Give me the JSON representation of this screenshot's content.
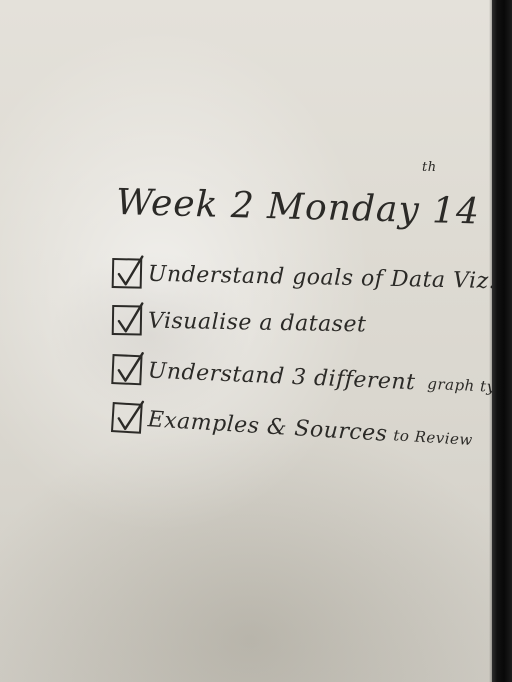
{
  "whiteboard": {
    "title": "Week 2 Monday 14",
    "title_superscript": "th",
    "checklist": [
      {
        "text": "Understand goals of Data Viz.",
        "checked": true
      },
      {
        "text": "Visualise a dataset",
        "checked": true
      },
      {
        "text": "Understand 3 different",
        "tail": "graph types",
        "checked": true
      },
      {
        "text": "Examples & Sources",
        "tail": "to Review",
        "checked": true
      }
    ],
    "ink_color": "#2b2a27",
    "board_color": "#dedbd3",
    "frame_color": "#0b0b0b"
  }
}
